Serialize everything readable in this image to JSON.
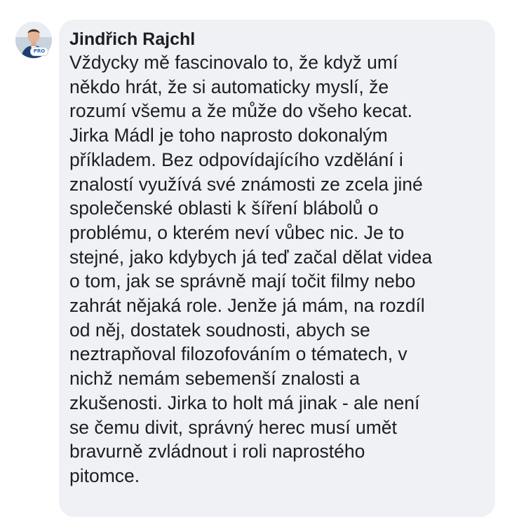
{
  "comment": {
    "author": "Jindřich Rajchl",
    "avatar_badge": "PRO",
    "text": "Vždycky mě fascinovalo to, že když umí\nněkdo hrát, že si automaticky myslí, že\nrozumí všemu a že může do všeho kecat.\nJirka Mádl je toho naprosto dokonalým\npříkladem. Bez odpovídajícího vzdělání i\nznalostí využívá své známosti ze zcela jiné\nspolečenské oblasti k šíření blábolů o\nproblému, o kterém neví vůbec nic. Je to\nstejné, jako kdybych já teď začal dělat videa\no tom, jak se správně mají točit filmy nebo\nzahrát nějaká role. Jenže já mám, na rozdíl\nod něj, dostatek soudnosti, abych se\nneztrapňoval filozofováním o tématech, v\nnichž nemám sebemenší znalosti a\nzkušenosti. Jirka to holt má jinak -  ale není\nse čemu divit, správný herec musí umět\nbravurně zvládnout i roli naprostého\npitomce."
  },
  "colors": {
    "bubble_background": "#eff1f4",
    "text": "#1c1e21",
    "page_background": "#ffffff"
  }
}
